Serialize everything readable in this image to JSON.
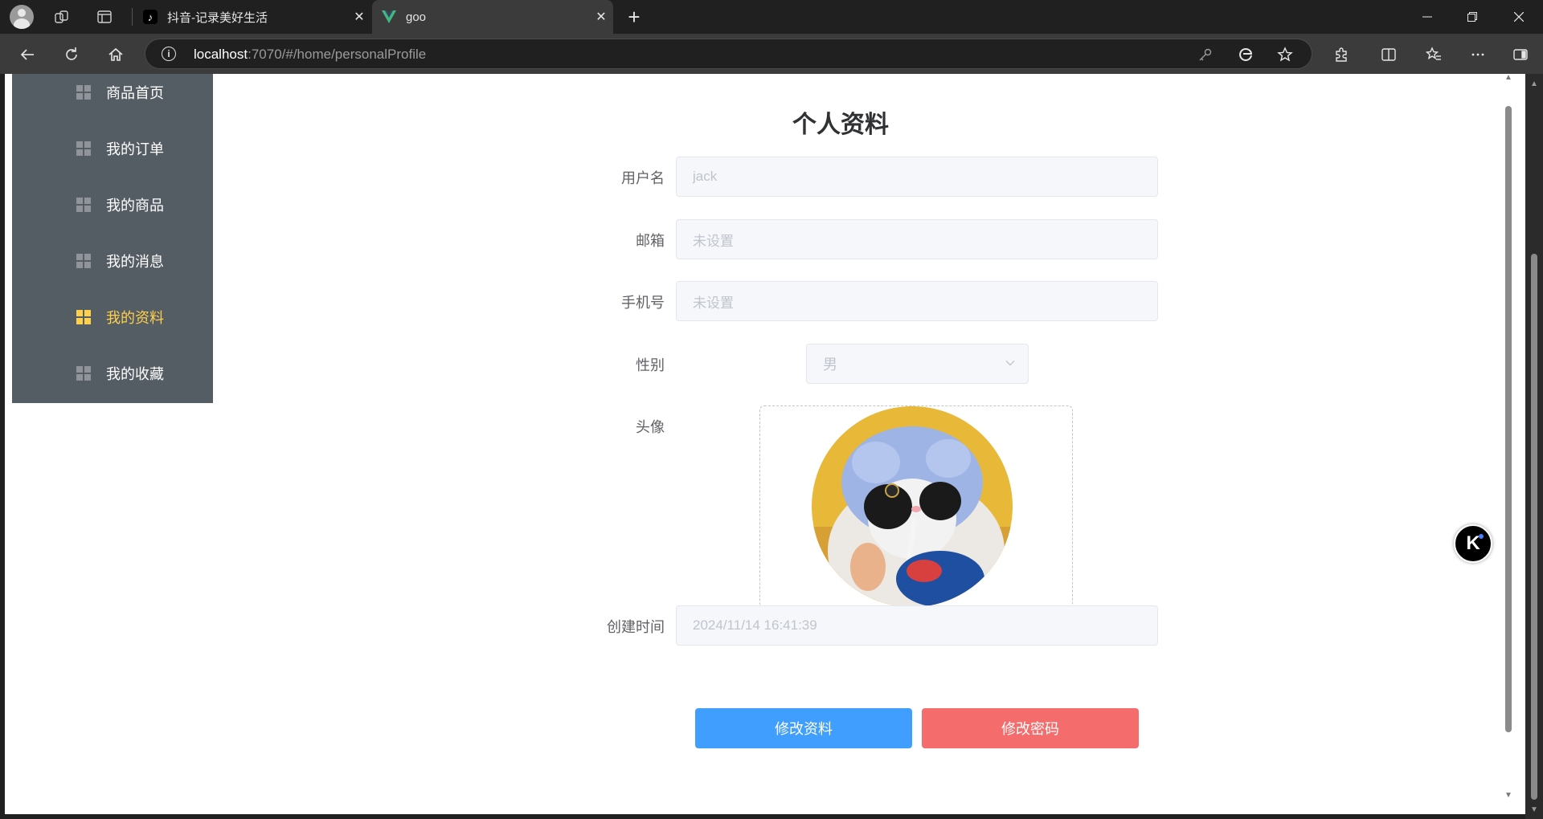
{
  "browser": {
    "tabs": [
      {
        "title": "抖音-记录美好生活",
        "favicon": "tiktok-icon",
        "active": false
      },
      {
        "title": "goo",
        "favicon": "vue-icon",
        "active": true
      }
    ],
    "url_host": "localhost",
    "url_rest": ":7070/#/home/personalProfile",
    "info_glyph": "i",
    "close_glyph": "✕",
    "new_tab_glyph": "+"
  },
  "sidebar": {
    "items": [
      {
        "label": "商品首页",
        "icon": "grid-icon",
        "active": false
      },
      {
        "label": "我的订单",
        "icon": "grid-icon",
        "active": false
      },
      {
        "label": "我的商品",
        "icon": "grid-icon",
        "active": false
      },
      {
        "label": "我的消息",
        "icon": "grid-icon",
        "active": false
      },
      {
        "label": "我的资料",
        "icon": "grid-icon",
        "active": true
      },
      {
        "label": "我的收藏",
        "icon": "grid-icon",
        "active": false
      }
    ]
  },
  "profile": {
    "title": "个人资料",
    "username_label": "用户名",
    "username_value": "jack",
    "email_label": "邮箱",
    "email_placeholder": "未设置",
    "phone_label": "手机号",
    "phone_placeholder": "未设置",
    "gender_label": "性别",
    "gender_value": "男",
    "avatar_label": "头像",
    "created_label": "创建时间",
    "created_value": "2024/11/14 16:41:39",
    "edit_profile_button": "修改资料",
    "change_password_button": "修改密码"
  },
  "floating": {
    "badge_letter": "K"
  },
  "colors": {
    "sidebar_bg": "#545c64",
    "menu_active": "#ffd04b",
    "primary": "#409eff",
    "danger": "#f56c6c"
  }
}
